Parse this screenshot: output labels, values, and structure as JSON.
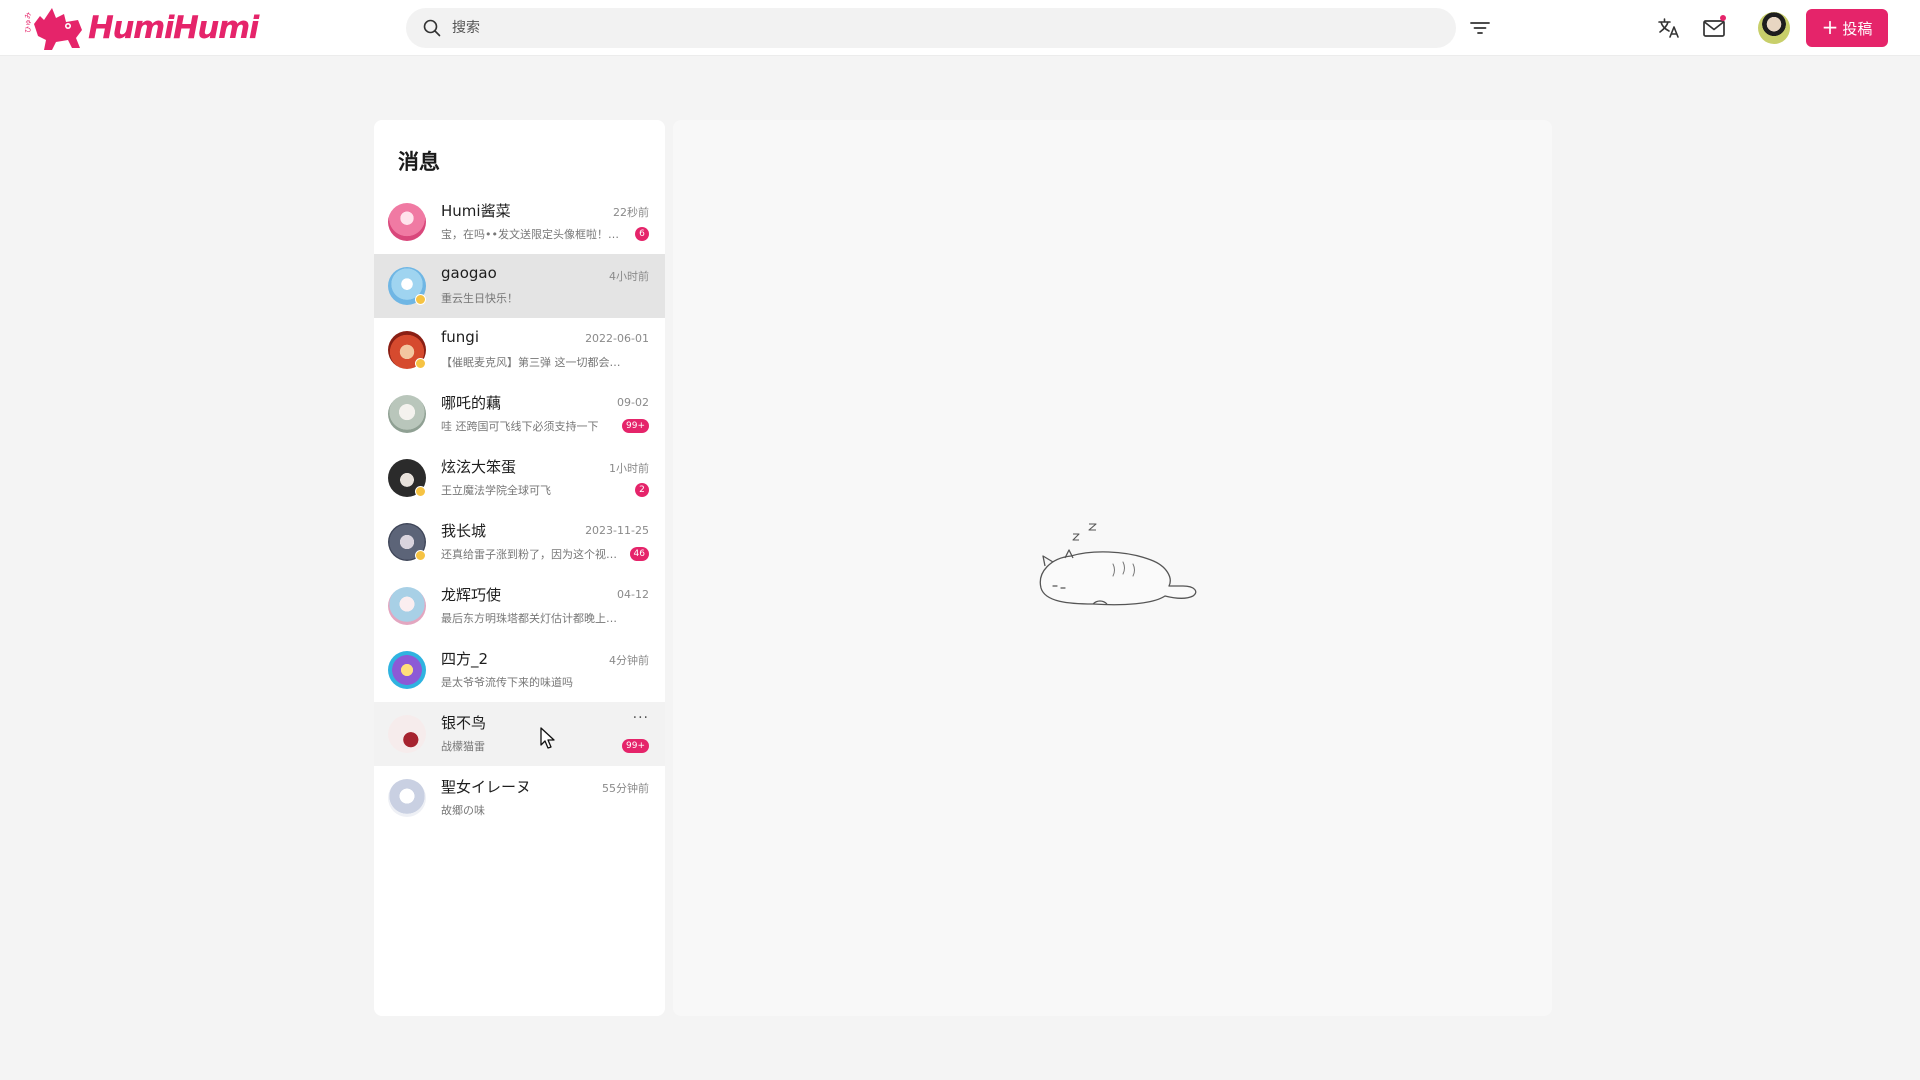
{
  "app": {
    "name": "HumiHumi",
    "logo_small_text": "ひゅみ"
  },
  "topbar": {
    "search_placeholder": "搜索",
    "upload_label": "投稿",
    "accent_color": "#e5246a"
  },
  "messages": {
    "title": "消息",
    "conversations": [
      {
        "name": "Humi酱菜",
        "time": "22秒前",
        "preview": "宝，在吗••发文送限定头像框啦！快来领取吧",
        "unread": "6",
        "avatar": "#f3a3c0"
      },
      {
        "name": "gaogao",
        "time": "4小时前",
        "preview": "重云生日快乐！",
        "unread": "",
        "avatar": "#a9d7f2"
      },
      {
        "name": "fungi",
        "time": "2022-06-01",
        "preview": "【催眠麦克风】第三弹 这一切都会成为过去吧",
        "unread": "",
        "avatar": "#e0604a"
      },
      {
        "name": "哪吒的藕",
        "time": "09-02",
        "preview": "哇 还跨国可飞线下必须支持一下",
        "unread": "99+",
        "avatar": "#cfd8d0"
      },
      {
        "name": "炫泫大笨蛋",
        "time": "1小时前",
        "preview": "王立魔法学院全球可飞",
        "unread": "2",
        "avatar": "#3a3a3a"
      },
      {
        "name": "我长城",
        "time": "2023-11-25",
        "preview": "还真给雷子涨到粉了，因为这个视频涨粉",
        "unread": "46",
        "avatar": "#6f7a8f"
      },
      {
        "name": "龙辉巧使",
        "time": "04-12",
        "preview": "最后东方明珠塔都关灯估计都晚上了吧",
        "unread": "",
        "avatar": "#b8d7ea"
      },
      {
        "name": "四方_2",
        "time": "4分钟前",
        "preview": "是太爷爷流传下来的味道吗",
        "unread": "",
        "avatar": "#7a52c9"
      },
      {
        "name": "银不鸟",
        "time": "",
        "preview": "战檬猫雷",
        "unread": "99+",
        "avatar": "#f0e0e0"
      },
      {
        "name": "聖女イレーヌ",
        "time": "55分钟前",
        "preview": "故郷の味",
        "unread": "",
        "avatar": "#d7dbe6"
      }
    ]
  }
}
